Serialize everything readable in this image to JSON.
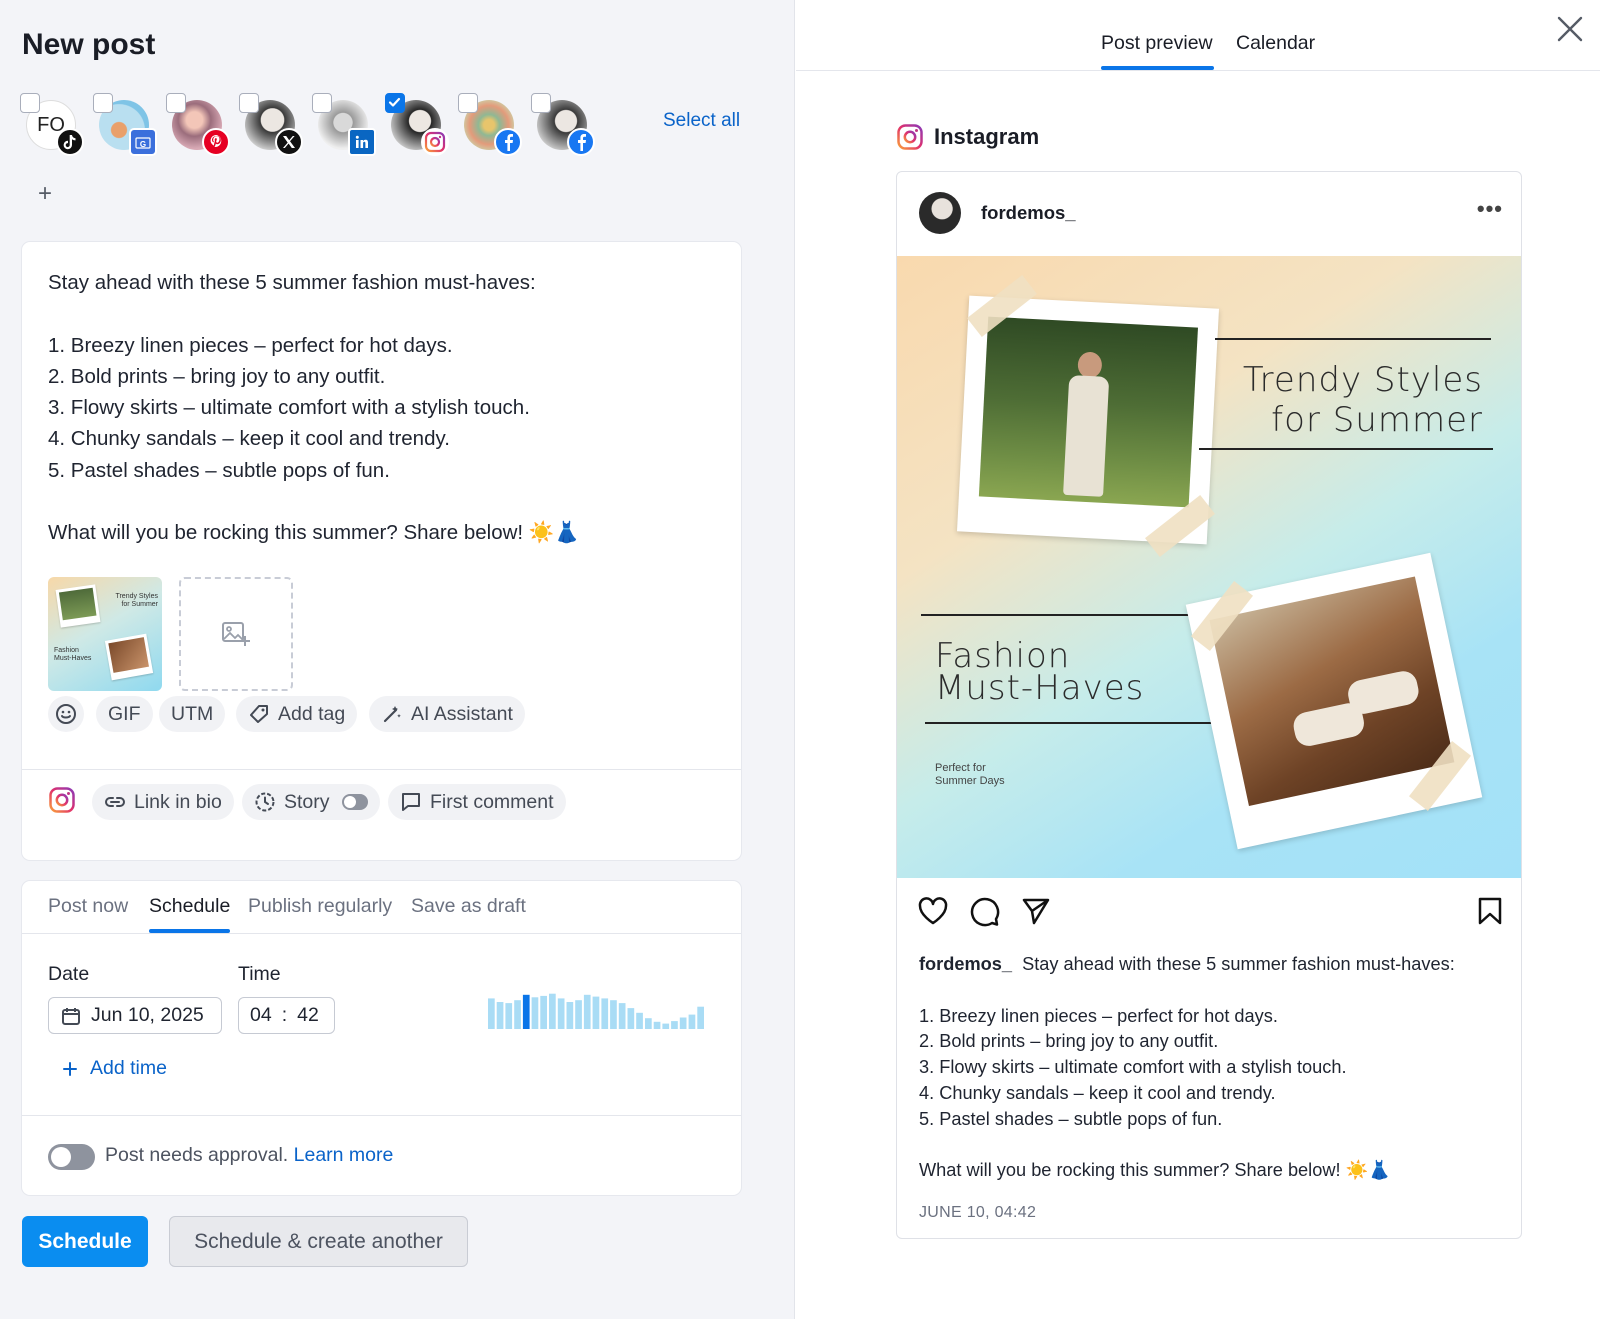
{
  "header": {
    "title": "New post"
  },
  "accounts": {
    "items": [
      {
        "name": "fordemos tiktok",
        "initials": "FO",
        "network": "tiktok",
        "checked": false
      },
      {
        "name": "fordemos google business",
        "network": "google-business",
        "checked": false
      },
      {
        "name": "fordemos pinterest",
        "network": "pinterest",
        "checked": false
      },
      {
        "name": "fordemos x",
        "network": "x",
        "checked": false
      },
      {
        "name": "fordemos linkedin",
        "network": "linkedin",
        "checked": false
      },
      {
        "name": "fordemos_ instagram",
        "network": "instagram",
        "checked": true
      },
      {
        "name": "fordemos facebook 1",
        "network": "facebook",
        "checked": false
      },
      {
        "name": "fordemos facebook 2",
        "network": "facebook",
        "checked": false
      }
    ],
    "select_all_label": "Select all",
    "add_icon": "+"
  },
  "composer": {
    "text": "Stay ahead with these 5 summer fashion must-haves:\n\n1. Breezy linen pieces – perfect for hot days.\n2. Bold prints – bring joy to any outfit.\n3. Flowy skirts – ultimate comfort with a stylish touch.\n4. Chunky sandals – keep it cool and trendy.\n5. Pastel shades – subtle pops of fun.\n\nWhat will you be rocking this summer? Share below! ☀️👗",
    "media_thumb_title": "Trendy Styles for Summer",
    "media_thumb_subtitle": "Fashion Must-Haves",
    "toolbar": {
      "gif": "GIF",
      "utm": "UTM",
      "add_tag": "Add tag",
      "ai_assistant": "AI Assistant"
    },
    "options": {
      "link_in_bio": "Link in bio",
      "story": "Story",
      "story_enabled": false,
      "first_comment": "First comment"
    }
  },
  "schedule": {
    "tabs": [
      "Post now",
      "Schedule",
      "Publish regularly",
      "Save as draft"
    ],
    "active_tab": "Schedule",
    "date_label": "Date",
    "date_value": "Jun 10, 2025",
    "time_label": "Time",
    "time_hour": "04",
    "time_minute": "42",
    "add_time_label": "Add time",
    "activity_bars": [
      0.85,
      0.75,
      0.72,
      0.8,
      0.95,
      0.88,
      0.92,
      0.98,
      0.85,
      0.75,
      0.8,
      0.95,
      0.9,
      0.85,
      0.8,
      0.72,
      0.58,
      0.45,
      0.3,
      0.2,
      0.15,
      0.22,
      0.32,
      0.4,
      0.62
    ],
    "activity_highlight_index": 4,
    "approval_text": "Post needs approval.",
    "approval_link": "Learn more",
    "approval_enabled": false
  },
  "actions": {
    "schedule_label": "Schedule",
    "schedule_another_label": "Schedule & create another"
  },
  "preview": {
    "tabs": [
      "Post preview",
      "Calendar"
    ],
    "active_tab": "Post preview",
    "network_label": "Instagram",
    "username": "fordemos_",
    "more_icon": "•••",
    "image_title_line1": "Trendy Styles",
    "image_title_line2": "for Summer",
    "image_subtitle_line1": "Fashion",
    "image_subtitle_line2": "Must-Haves",
    "image_small_line1": "Perfect for",
    "image_small_line2": "Summer Days",
    "caption_first": "Stay ahead with these 5 summer fashion must-haves:",
    "caption_rest": "1. Breezy linen pieces – perfect for hot days.\n2. Bold prints – bring joy to any outfit.\n3. Flowy skirts – ultimate comfort with a stylish touch.\n4. Chunky sandals – keep it cool and trendy.\n5. Pastel shades – subtle pops of fun.\n\nWhat will you be rocking this summer? Share below! ☀️👗",
    "date": "JUNE 10, 04:42"
  },
  "colors": {
    "accent": "#0a75e8",
    "primary_button": "#0a8df0",
    "link": "#0a63c9",
    "background": "#f3f4f8"
  }
}
